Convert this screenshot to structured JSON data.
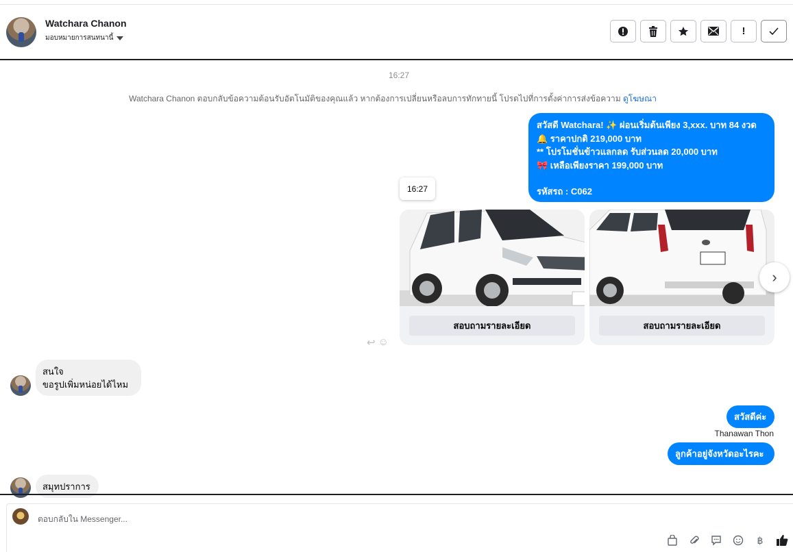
{
  "header": {
    "name": "Watchara Chanon",
    "assign_label": "มอบหมายการสนทนานี้",
    "actions": [
      {
        "icon": "alert-circle-icon",
        "glyph": "❗"
      },
      {
        "icon": "trash-icon",
        "glyph": "🗑"
      },
      {
        "icon": "star-icon",
        "glyph": "★"
      },
      {
        "icon": "mail-icon",
        "glyph": "✉"
      },
      {
        "icon": "exclamation-icon",
        "glyph": "!"
      },
      {
        "icon": "check-icon",
        "glyph": "✓"
      }
    ]
  },
  "conversation": {
    "timestamp": "16:27",
    "system_note": "Watchara Chanon ตอบกลับข้อความต้อนรับอัตโนมัติของคุณแล้ว หากต้องการเปลี่ยนหรือลบการทักทายนี้ โปรดไปที่การตั้งค่าการส่งข้อความ",
    "system_link": "ดูโฆษณา",
    "promo_lines": [
      "สวัสดี Watchara! ✨  ผ่อนเริ่มต้นเพียง 3,xxx. บาท 84 งวด",
      "🔔 ราคาปกติ 219,000 บาท",
      "** โปรโมชั่นข้าวแลกลด รับส่วนลด 20,000 บาท",
      "🎀  เหลือเพียงราคา 199,000 บาท",
      "",
      "รหัสรถ : C062"
    ],
    "hover_time": "16:27",
    "cards": [
      {
        "cta": "สอบถามรายละเอียด"
      },
      {
        "cta": "สอบถามรายละเอียด"
      }
    ],
    "incoming_1_lines": [
      "สนใจ",
      "ขอรูปเพิ่มหน่อยได้ไหม"
    ],
    "outgoing_1": "สวัสดีค่ะ",
    "sender_name": "Thanawan Thon",
    "outgoing_2": "ลูกค้าอยู่จังหวัดอะไรคะ",
    "incoming_2": "สมุทปราการ"
  },
  "composer": {
    "placeholder": "ตอบกลับใน Messenger...",
    "tools": [
      "bag-icon",
      "paperclip-icon",
      "chat-icon",
      "emoji-icon",
      "baht-icon",
      "thumbs-up-icon"
    ]
  },
  "colors": {
    "outgoing_bubble": "#0084ff",
    "incoming_bubble": "#f0f0f0",
    "link": "#216fdb"
  }
}
